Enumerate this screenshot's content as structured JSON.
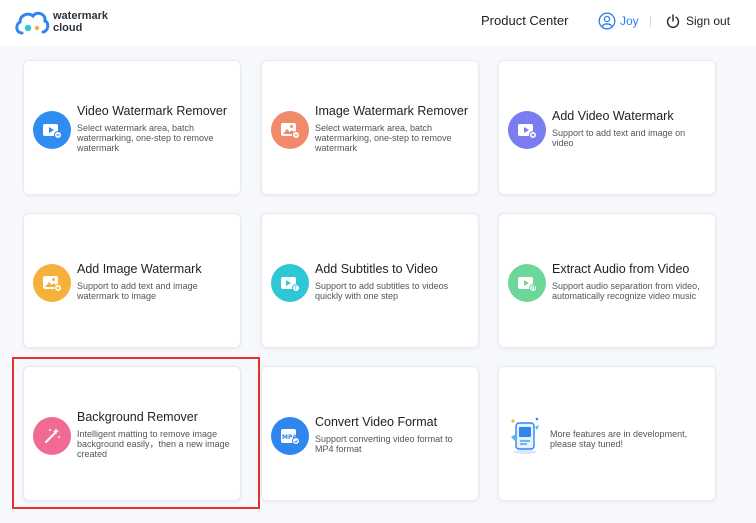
{
  "header": {
    "logo_line1": "watermark",
    "logo_line2": "cloud",
    "product_center": "Product Center",
    "user_name": "Joy",
    "sign_out": "Sign out"
  },
  "cards": [
    {
      "title": "Video Watermark Remover",
      "desc": "Select watermark area, batch watermarking, one-step to remove watermark",
      "icon": "video-icon"
    },
    {
      "title": "Image Watermark Remover",
      "desc": "Select watermark area, batch watermarking, one-step to remove watermark",
      "icon": "image-icon"
    },
    {
      "title": "Add Video Watermark",
      "desc": "Support to add text and image on video",
      "icon": "video-add-icon"
    },
    {
      "title": "Add Image Watermark",
      "desc": "Support to add text and image watermark to image",
      "icon": "image-add-icon"
    },
    {
      "title": "Add Subtitles to Video",
      "desc": "Support to add subtitles to videos quickly with one step",
      "icon": "subtitle-icon"
    },
    {
      "title": "Extract Audio from Video",
      "desc": "Support audio separation from video, automatically recognize video music",
      "icon": "audio-icon"
    },
    {
      "title": "Background Remover",
      "desc": "Intelligent matting to remove image background easily，then a new image created",
      "icon": "magic-wand-icon"
    },
    {
      "title": "Convert Video Format",
      "desc": "Support converting video format to MP4 format",
      "icon": "mp4-icon",
      "badge": "MP4"
    },
    {
      "title": "",
      "desc": "More features are in development, please stay tuned!",
      "icon": "development-illustration-icon"
    }
  ],
  "colors": {
    "accent": "#2f7cf6",
    "highlight": "#e0322c"
  }
}
